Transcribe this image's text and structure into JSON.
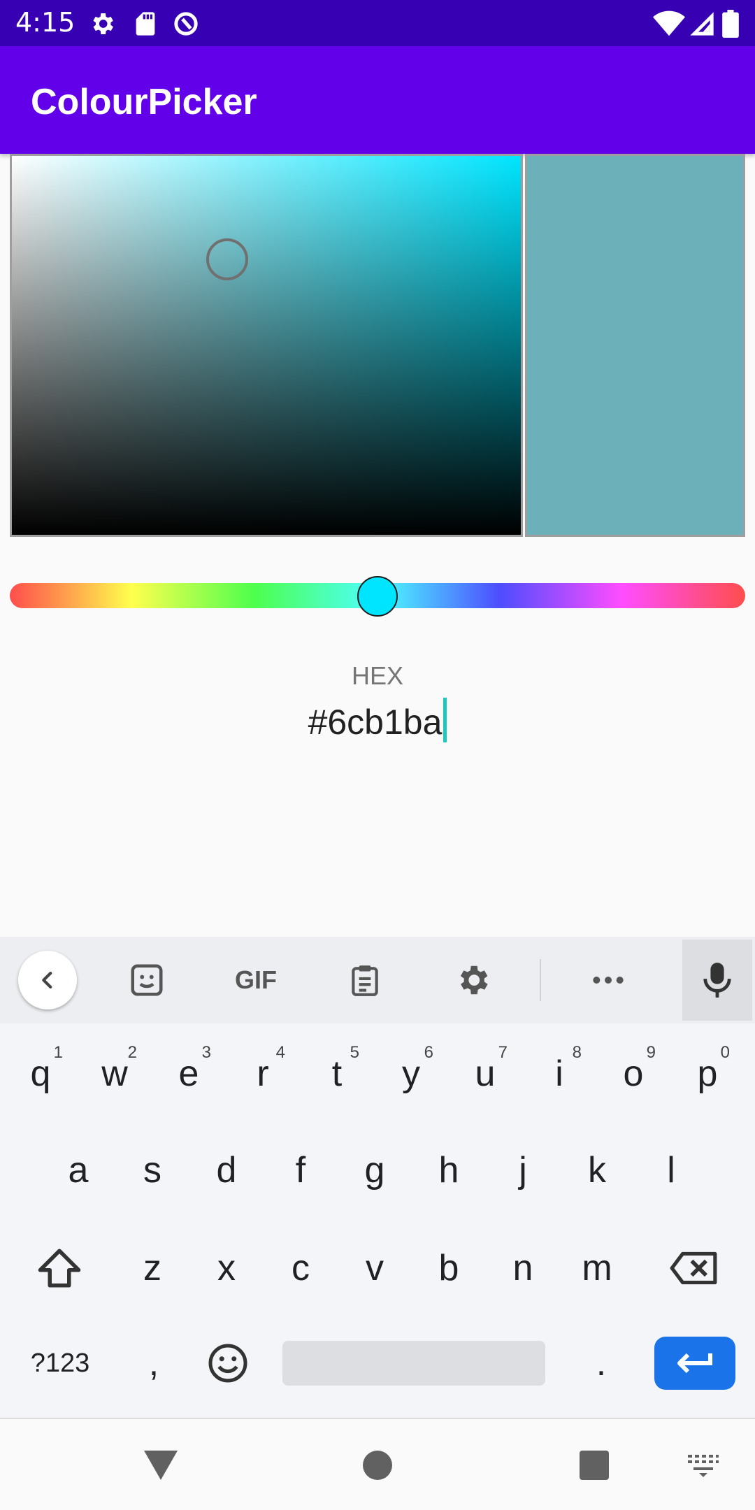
{
  "status_bar": {
    "time": "4:15",
    "icons": [
      "settings-icon",
      "sd-card-icon",
      "data-saver-icon",
      "wifi-icon",
      "signal-icon",
      "battery-icon"
    ]
  },
  "app_bar": {
    "title": "ColourPicker",
    "color": "#6200ea"
  },
  "picker": {
    "hue_color": "#00e5ff",
    "selected_color": "#6cb1ba",
    "hue_position": 0.5
  },
  "hex": {
    "label": "HEX",
    "value": "#6cb1ba"
  },
  "keyboard": {
    "toolbar": [
      "back-icon",
      "sticker-icon",
      "gif-icon",
      "clipboard-icon",
      "settings-icon",
      "more-icon",
      "mic-icon"
    ],
    "gif_label": "GIF",
    "row1": [
      {
        "key": "q",
        "hint": "1"
      },
      {
        "key": "w",
        "hint": "2"
      },
      {
        "key": "e",
        "hint": "3"
      },
      {
        "key": "r",
        "hint": "4"
      },
      {
        "key": "t",
        "hint": "5"
      },
      {
        "key": "y",
        "hint": "6"
      },
      {
        "key": "u",
        "hint": "7"
      },
      {
        "key": "i",
        "hint": "8"
      },
      {
        "key": "o",
        "hint": "9"
      },
      {
        "key": "p",
        "hint": "0"
      }
    ],
    "row2": [
      "a",
      "s",
      "d",
      "f",
      "g",
      "h",
      "j",
      "k",
      "l"
    ],
    "row3": [
      "z",
      "x",
      "c",
      "v",
      "b",
      "n",
      "m"
    ],
    "symbols_label": "?123",
    "comma": ",",
    "period": ".",
    "enter_color": "#1a73e8"
  },
  "nav_bar": [
    "back-triangle-icon",
    "home-circle-icon",
    "recents-square-icon",
    "keyboard-switch-icon"
  ]
}
